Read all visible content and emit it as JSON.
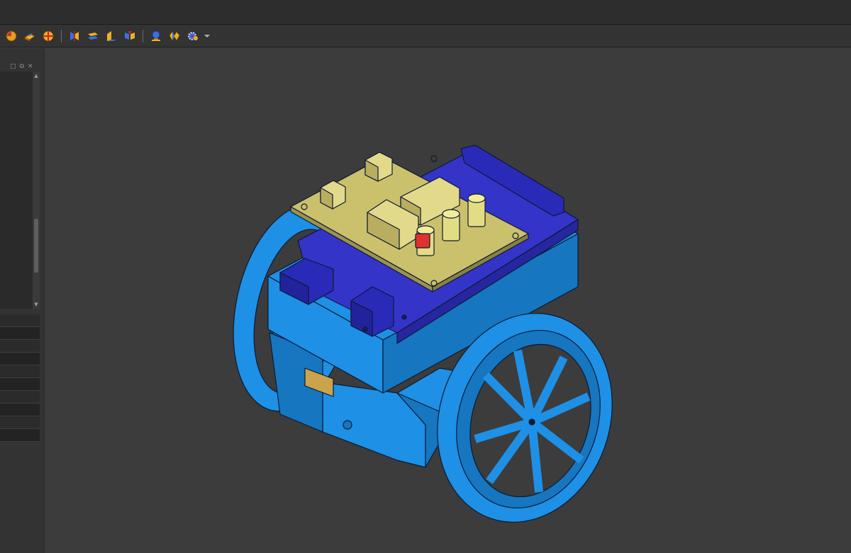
{
  "toolbar": {
    "groups": [
      [
        "shaded-sphere-icon",
        "shaded-box-icon",
        "render-sphere-icon"
      ],
      [
        "section-view-icon",
        "plane-icon",
        "mirror-plane-icon",
        "split-view-icon"
      ],
      [
        "camera-view-icon",
        "appearance-icon",
        "gear-settings-icon"
      ]
    ]
  },
  "colors": {
    "background": "#3c3c3c",
    "chassis": "#1e90e6",
    "board_dark": "#3434c8",
    "pcb": "#cbc06c",
    "capacitor": "#e2dd85",
    "led": "#e23030"
  }
}
